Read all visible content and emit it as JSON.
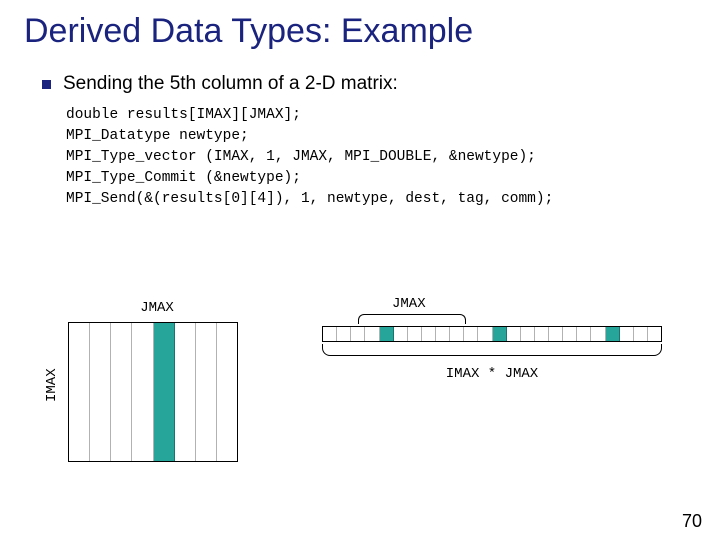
{
  "title": "Derived Data Types: Example",
  "bullet_text": "Sending the 5th column of a 2-D matrix:",
  "code": "double results[IMAX][JMAX];\nMPI_Datatype newtype;\nMPI_Type_vector (IMAX, 1, JMAX, MPI_DOUBLE, &newtype);\nMPI_Type_Commit (&newtype);\nMPI_Send(&(results[0][4]), 1, newtype, dest, tag, comm);",
  "diagram": {
    "matrix_top_label": "JMAX",
    "matrix_side_label": "IMAX",
    "matrix_columns": 8,
    "matrix_highlight_col": 4,
    "strip_top_label": "JMAX",
    "strip_bottom_label": "IMAX * JMAX",
    "strip_groups": 3,
    "strip_group_size": 8,
    "strip_highlight_index": 4
  },
  "page_number": "70"
}
